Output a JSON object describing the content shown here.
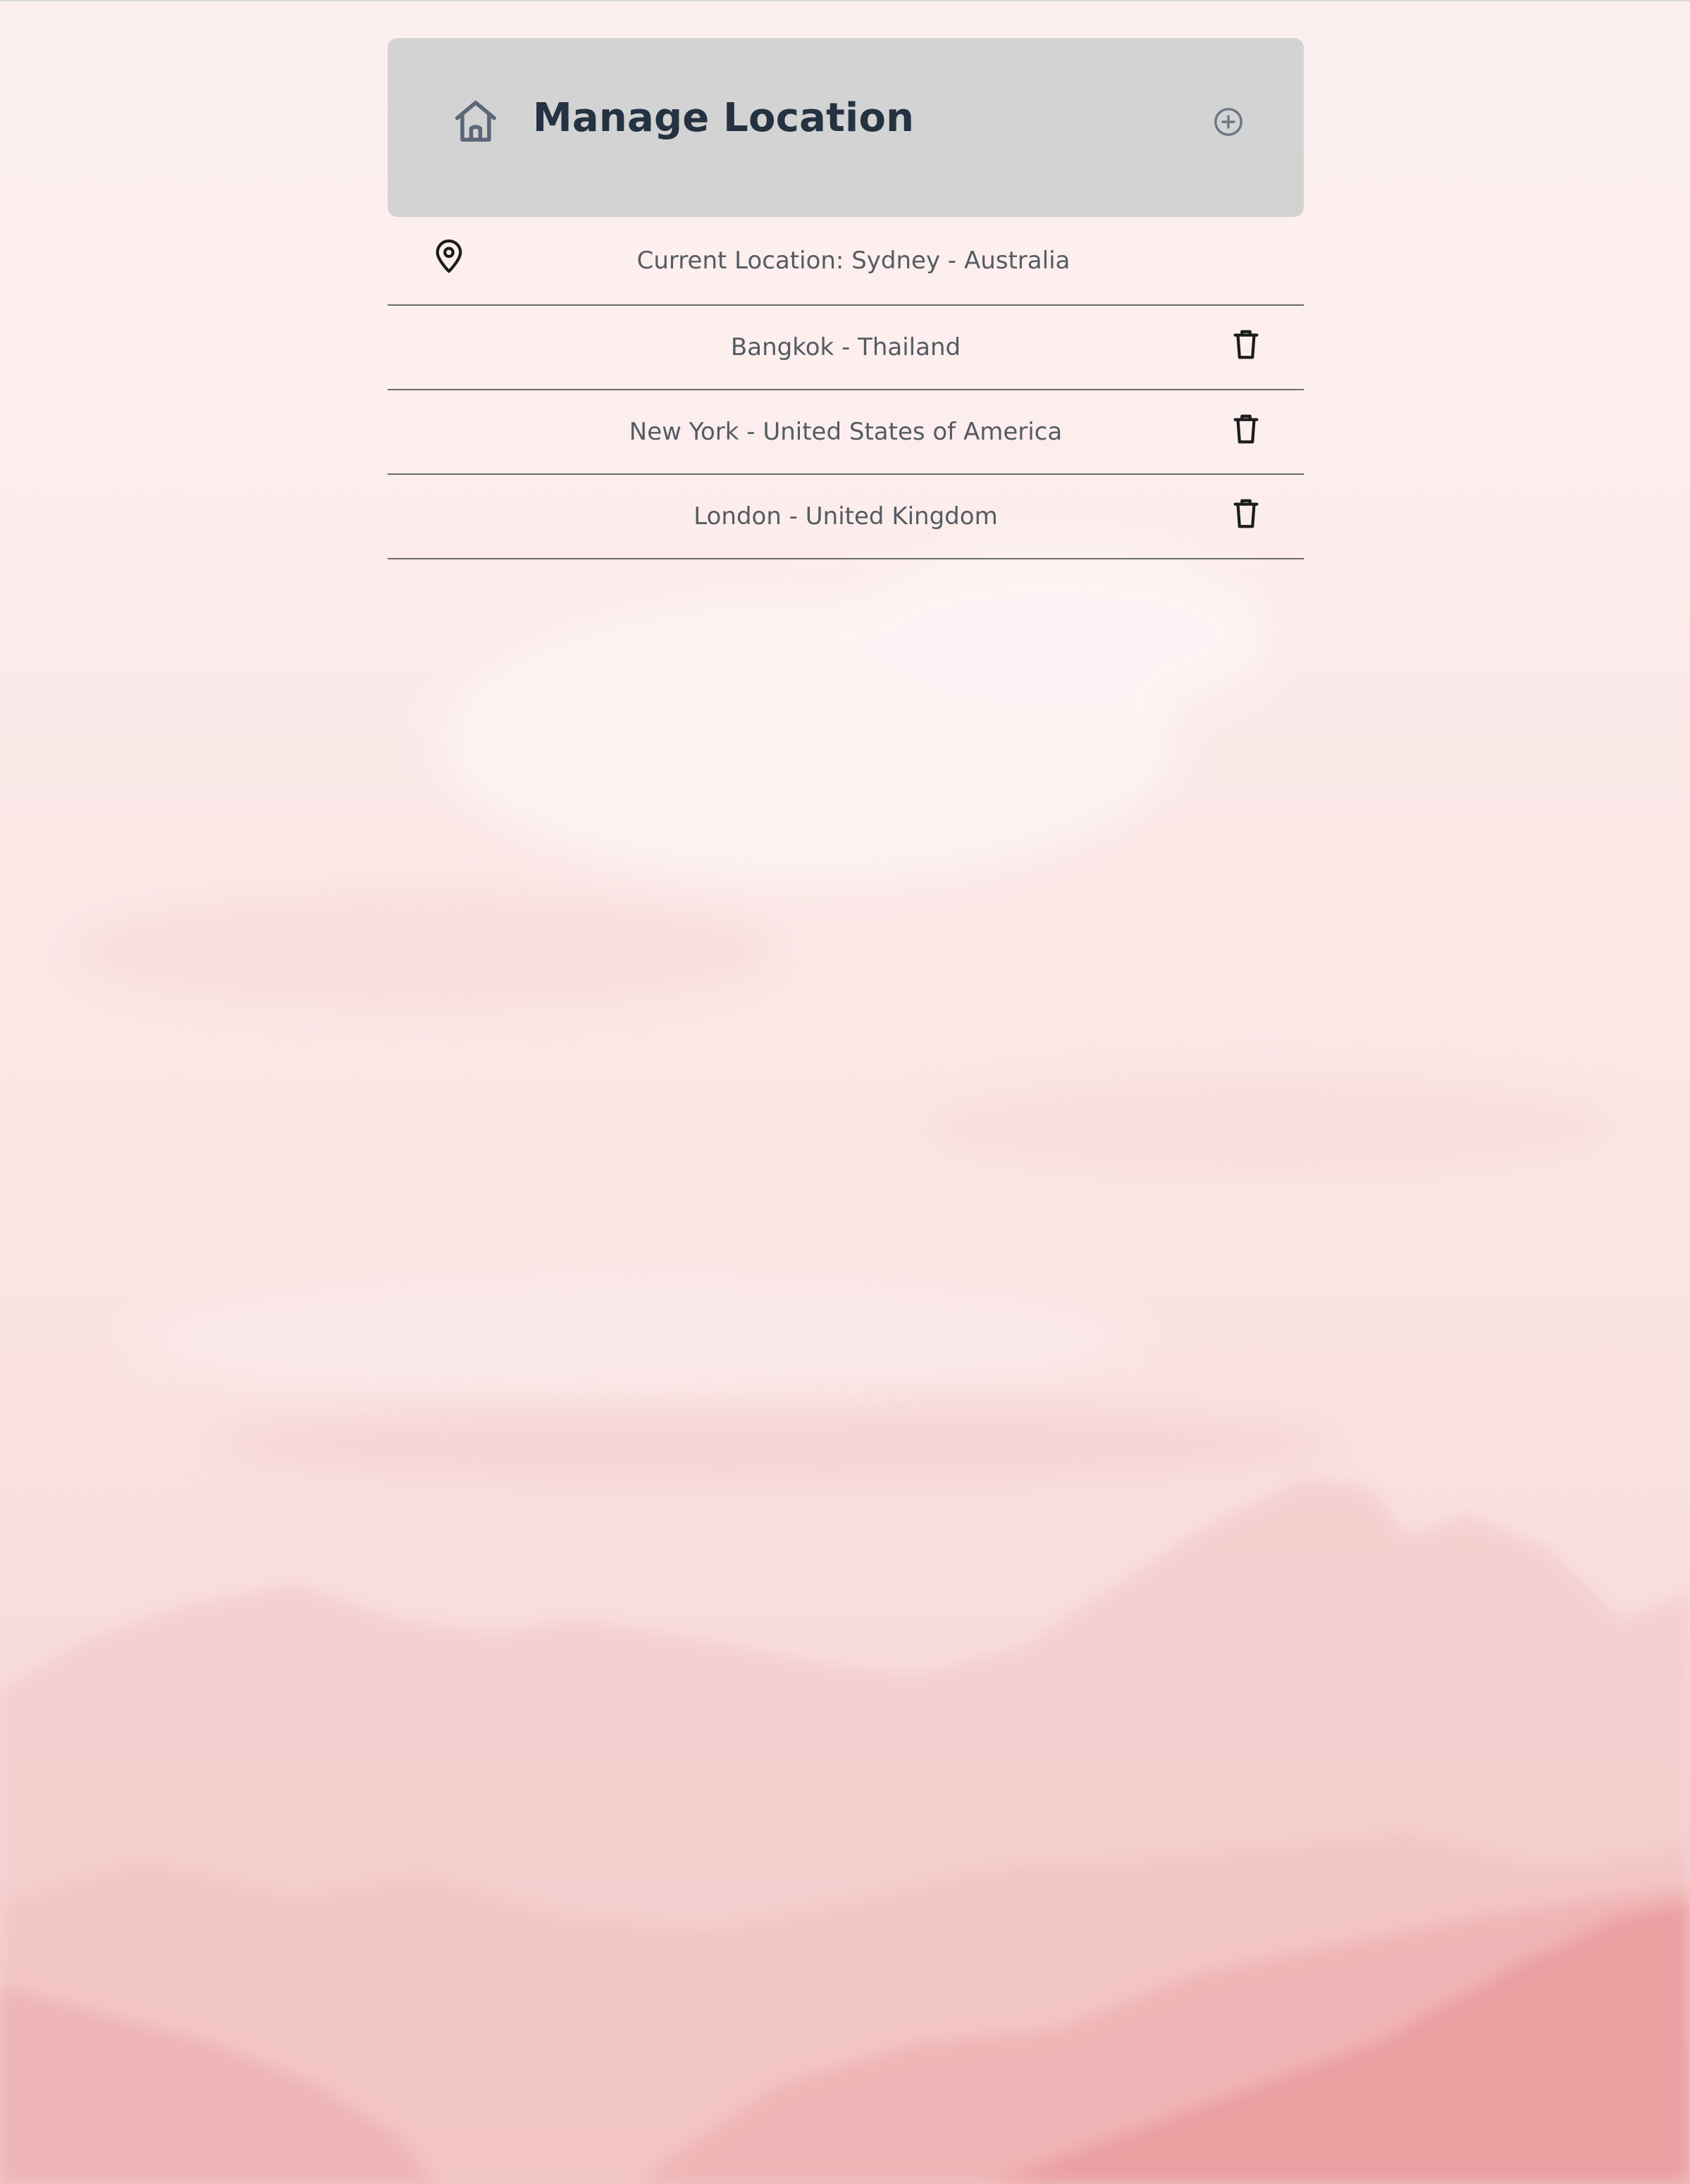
{
  "header": {
    "title": "Manage Location",
    "home_icon": "home-icon",
    "add_icon": "plus-circle-icon"
  },
  "current_location": {
    "label": "Current Location: Sydney - Australia",
    "icon": "map-pin-icon"
  },
  "locations": [
    {
      "name": "Bangkok - Thailand",
      "delete_icon": "trash-icon"
    },
    {
      "name": "New York - United States of America",
      "delete_icon": "trash-icon"
    },
    {
      "name": "London - United Kingdom",
      "delete_icon": "trash-icon"
    }
  ],
  "colors": {
    "header_bg": "#d3d3d3",
    "title_text": "#243242",
    "row_text": "#555b62",
    "divider": "#6c6c6c",
    "background_pink": "#f1c8c8"
  }
}
